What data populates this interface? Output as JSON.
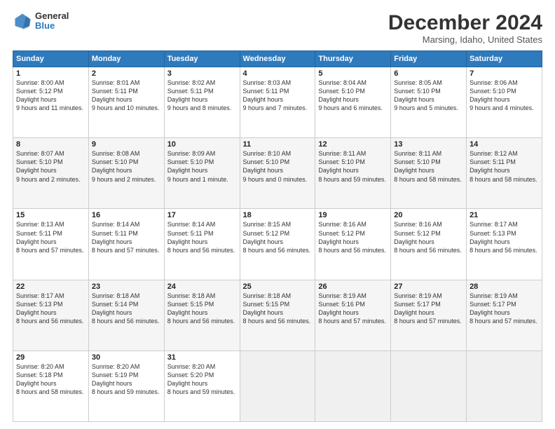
{
  "logo": {
    "general": "General",
    "blue": "Blue"
  },
  "title": {
    "month": "December 2024",
    "location": "Marsing, Idaho, United States"
  },
  "headers": [
    "Sunday",
    "Monday",
    "Tuesday",
    "Wednesday",
    "Thursday",
    "Friday",
    "Saturday"
  ],
  "weeks": [
    [
      {
        "day": "1",
        "rise": "8:00 AM",
        "set": "5:12 PM",
        "daylight": "9 hours and 11 minutes."
      },
      {
        "day": "2",
        "rise": "8:01 AM",
        "set": "5:11 PM",
        "daylight": "9 hours and 10 minutes."
      },
      {
        "day": "3",
        "rise": "8:02 AM",
        "set": "5:11 PM",
        "daylight": "9 hours and 8 minutes."
      },
      {
        "day": "4",
        "rise": "8:03 AM",
        "set": "5:11 PM",
        "daylight": "9 hours and 7 minutes."
      },
      {
        "day": "5",
        "rise": "8:04 AM",
        "set": "5:10 PM",
        "daylight": "9 hours and 6 minutes."
      },
      {
        "day": "6",
        "rise": "8:05 AM",
        "set": "5:10 PM",
        "daylight": "9 hours and 5 minutes."
      },
      {
        "day": "7",
        "rise": "8:06 AM",
        "set": "5:10 PM",
        "daylight": "9 hours and 4 minutes."
      }
    ],
    [
      {
        "day": "8",
        "rise": "8:07 AM",
        "set": "5:10 PM",
        "daylight": "9 hours and 2 minutes."
      },
      {
        "day": "9",
        "rise": "8:08 AM",
        "set": "5:10 PM",
        "daylight": "9 hours and 2 minutes."
      },
      {
        "day": "10",
        "rise": "8:09 AM",
        "set": "5:10 PM",
        "daylight": "9 hours and 1 minute."
      },
      {
        "day": "11",
        "rise": "8:10 AM",
        "set": "5:10 PM",
        "daylight": "9 hours and 0 minutes."
      },
      {
        "day": "12",
        "rise": "8:11 AM",
        "set": "5:10 PM",
        "daylight": "8 hours and 59 minutes."
      },
      {
        "day": "13",
        "rise": "8:11 AM",
        "set": "5:10 PM",
        "daylight": "8 hours and 58 minutes."
      },
      {
        "day": "14",
        "rise": "8:12 AM",
        "set": "5:11 PM",
        "daylight": "8 hours and 58 minutes."
      }
    ],
    [
      {
        "day": "15",
        "rise": "8:13 AM",
        "set": "5:11 PM",
        "daylight": "8 hours and 57 minutes."
      },
      {
        "day": "16",
        "rise": "8:14 AM",
        "set": "5:11 PM",
        "daylight": "8 hours and 57 minutes."
      },
      {
        "day": "17",
        "rise": "8:14 AM",
        "set": "5:11 PM",
        "daylight": "8 hours and 56 minutes."
      },
      {
        "day": "18",
        "rise": "8:15 AM",
        "set": "5:12 PM",
        "daylight": "8 hours and 56 minutes."
      },
      {
        "day": "19",
        "rise": "8:16 AM",
        "set": "5:12 PM",
        "daylight": "8 hours and 56 minutes."
      },
      {
        "day": "20",
        "rise": "8:16 AM",
        "set": "5:12 PM",
        "daylight": "8 hours and 56 minutes."
      },
      {
        "day": "21",
        "rise": "8:17 AM",
        "set": "5:13 PM",
        "daylight": "8 hours and 56 minutes."
      }
    ],
    [
      {
        "day": "22",
        "rise": "8:17 AM",
        "set": "5:13 PM",
        "daylight": "8 hours and 56 minutes."
      },
      {
        "day": "23",
        "rise": "8:18 AM",
        "set": "5:14 PM",
        "daylight": "8 hours and 56 minutes."
      },
      {
        "day": "24",
        "rise": "8:18 AM",
        "set": "5:15 PM",
        "daylight": "8 hours and 56 minutes."
      },
      {
        "day": "25",
        "rise": "8:18 AM",
        "set": "5:15 PM",
        "daylight": "8 hours and 56 minutes."
      },
      {
        "day": "26",
        "rise": "8:19 AM",
        "set": "5:16 PM",
        "daylight": "8 hours and 57 minutes."
      },
      {
        "day": "27",
        "rise": "8:19 AM",
        "set": "5:17 PM",
        "daylight": "8 hours and 57 minutes."
      },
      {
        "day": "28",
        "rise": "8:19 AM",
        "set": "5:17 PM",
        "daylight": "8 hours and 57 minutes."
      }
    ],
    [
      {
        "day": "29",
        "rise": "8:20 AM",
        "set": "5:18 PM",
        "daylight": "8 hours and 58 minutes."
      },
      {
        "day": "30",
        "rise": "8:20 AM",
        "set": "5:19 PM",
        "daylight": "8 hours and 59 minutes."
      },
      {
        "day": "31",
        "rise": "8:20 AM",
        "set": "5:20 PM",
        "daylight": "8 hours and 59 minutes."
      },
      null,
      null,
      null,
      null
    ]
  ]
}
